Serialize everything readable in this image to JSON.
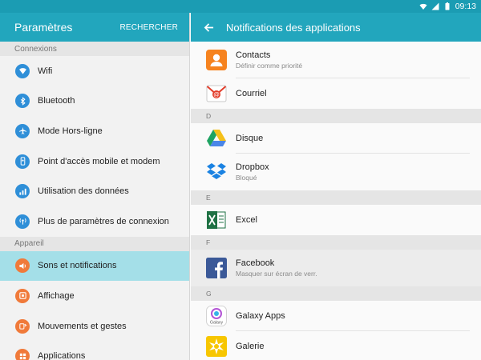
{
  "status_bar": {
    "time": "09:13"
  },
  "left_pane": {
    "title": "Paramètres",
    "search": "RECHERCHER",
    "sections": [
      {
        "header": "Connexions",
        "items": [
          {
            "label": "Wifi",
            "icon": "wifi-icon",
            "color": "#2f8fd8"
          },
          {
            "label": "Bluetooth",
            "icon": "bluetooth-icon",
            "color": "#2f8fd8"
          },
          {
            "label": "Mode Hors-ligne",
            "icon": "airplane-icon",
            "color": "#2f8fd8"
          },
          {
            "label": "Point d'accès mobile et modem",
            "icon": "hotspot-icon",
            "color": "#2f8fd8"
          },
          {
            "label": "Utilisation des données",
            "icon": "data-usage-icon",
            "color": "#2f8fd8"
          },
          {
            "label": "Plus de paramètres de connexion",
            "icon": "more-connections-icon",
            "color": "#2f8fd8"
          }
        ]
      },
      {
        "header": "Appareil",
        "items": [
          {
            "label": "Sons et notifications",
            "icon": "sound-icon",
            "color": "#f07a3a",
            "selected": true
          },
          {
            "label": "Affichage",
            "icon": "display-icon",
            "color": "#f07a3a"
          },
          {
            "label": "Mouvements et gestes",
            "icon": "motion-icon",
            "color": "#f07a3a"
          },
          {
            "label": "Applications",
            "icon": "applications-icon",
            "color": "#f07a3a"
          }
        ]
      }
    ]
  },
  "right_pane": {
    "title": "Notifications des applications",
    "groups": [
      {
        "letter": null,
        "apps": [
          {
            "name": "Contacts",
            "sub": "Définir comme priorité",
            "icon": "contacts-icon"
          },
          {
            "name": "Courriel",
            "sub": null,
            "icon": "email-icon"
          }
        ]
      },
      {
        "letter": "D",
        "apps": [
          {
            "name": "Disque",
            "sub": null,
            "icon": "drive-icon"
          },
          {
            "name": "Dropbox",
            "sub": "Bloqué",
            "icon": "dropbox-icon"
          }
        ]
      },
      {
        "letter": "E",
        "apps": [
          {
            "name": "Excel",
            "sub": null,
            "icon": "excel-icon"
          }
        ]
      },
      {
        "letter": "F",
        "apps": [
          {
            "name": "Facebook",
            "sub": "Masquer sur écran de verr.",
            "icon": "facebook-icon",
            "blocked": true
          }
        ]
      },
      {
        "letter": "G",
        "apps": [
          {
            "name": "Galaxy Apps",
            "sub": null,
            "icon": "galaxy-apps-icon"
          },
          {
            "name": "Galerie",
            "sub": null,
            "icon": "gallery-icon"
          }
        ]
      }
    ]
  },
  "colors": {
    "header_bar": "#22a6bd",
    "status_bar": "#1b9cb3",
    "selected_row": "#a4dfe8",
    "connections_icon": "#2f8fd8",
    "device_icon": "#f07a3a"
  },
  "icon_glyphs": {
    "galaxy_apps": "Galaxy",
    "email": "@"
  }
}
